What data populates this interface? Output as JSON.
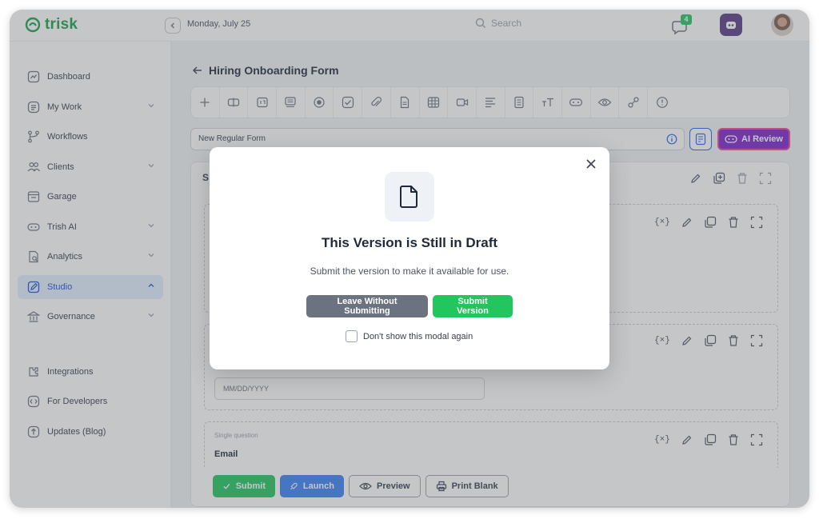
{
  "header": {
    "logo_text": "trisk",
    "date": "Monday, July 25",
    "search_placeholder": "Search",
    "chat_badge": "4"
  },
  "sidebar": {
    "items": [
      {
        "label": "Dashboard",
        "icon": "dashboard-icon",
        "has_chevron": false
      },
      {
        "label": "My Work",
        "icon": "my-work-icon",
        "has_chevron": true
      },
      {
        "label": "Workflows",
        "icon": "workflows-icon",
        "has_chevron": false
      },
      {
        "label": "Clients",
        "icon": "clients-icon",
        "has_chevron": true
      },
      {
        "label": "Garage",
        "icon": "garage-icon",
        "has_chevron": false
      },
      {
        "label": "Trish AI",
        "icon": "trish-ai-icon",
        "has_chevron": true
      },
      {
        "label": "Analytics",
        "icon": "analytics-icon",
        "has_chevron": true
      },
      {
        "label": "Studio",
        "icon": "studio-icon",
        "has_chevron": true,
        "active": true
      },
      {
        "label": "Governance",
        "icon": "governance-icon",
        "has_chevron": true
      },
      {
        "label": "Integrations",
        "icon": "integrations-icon",
        "has_chevron": false
      },
      {
        "label": "For Developers",
        "icon": "developers-icon",
        "has_chevron": false
      },
      {
        "label": "Updates (Blog)",
        "icon": "updates-icon",
        "has_chevron": false
      }
    ]
  },
  "main": {
    "back_title": "Hiring Onboarding Form",
    "form_name": "New Regular Form",
    "ai_review_label": "AI Review",
    "section_letter": "S",
    "questions": [
      {
        "small_label": "",
        "title": "",
        "input": ""
      },
      {
        "small_label": "",
        "title": "",
        "input": "MM/DD/YYYY"
      },
      {
        "small_label": "Single question",
        "title": "Email",
        "input": ""
      }
    ],
    "bottom_buttons": {
      "submit": "Submit",
      "launch": "Launch",
      "preview": "Preview",
      "print_blank": "Print Blank"
    }
  },
  "modal": {
    "title": "This Version is Still in Draft",
    "subtitle": "Submit the version to make it available for use.",
    "leave_label": "Leave Without Submitting",
    "submit_label": "Submit Version",
    "checkbox_label": "Don't show this modal again"
  },
  "colors": {
    "brand_green": "#16a34a",
    "submit_green": "#22c55e",
    "studio_blue": "#1d4ed8",
    "ai_purple": "#7e22ce",
    "leave_gray": "#6b7280"
  }
}
